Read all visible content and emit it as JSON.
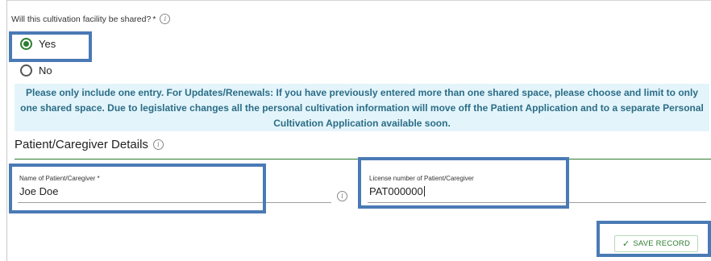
{
  "question": {
    "label": "Will this cultivation facility be shared?",
    "required_mark": "*",
    "info_icon": "i"
  },
  "options": [
    {
      "label": "Yes",
      "selected": true
    },
    {
      "label": "No",
      "selected": false
    }
  ],
  "notice": {
    "text": "Please only include one entry. For Updates/Renewals: If you have previously entered more than one shared space, please choose and limit to only one shared space. Due to legislative changes all the personal cultivation information will move off the Patient Application and to a separate Personal Cultivation Application available soon."
  },
  "section": {
    "title": "Patient/Caregiver Details",
    "info_icon": "i"
  },
  "fields": {
    "name": {
      "label": "Name of Patient/Caregiver *",
      "value": "Joe Doe"
    },
    "license": {
      "label": "License number of Patient/Caregiver",
      "value": "PAT000000"
    },
    "info_icon": "i"
  },
  "actions": {
    "save_check": "✓",
    "save_label": "SAVE RECORD"
  },
  "colors": {
    "accent_green": "#2e7d32",
    "notice_bg": "#e3f4fb",
    "notice_text": "#2b6d86",
    "highlight_border": "#4a7ab5"
  }
}
